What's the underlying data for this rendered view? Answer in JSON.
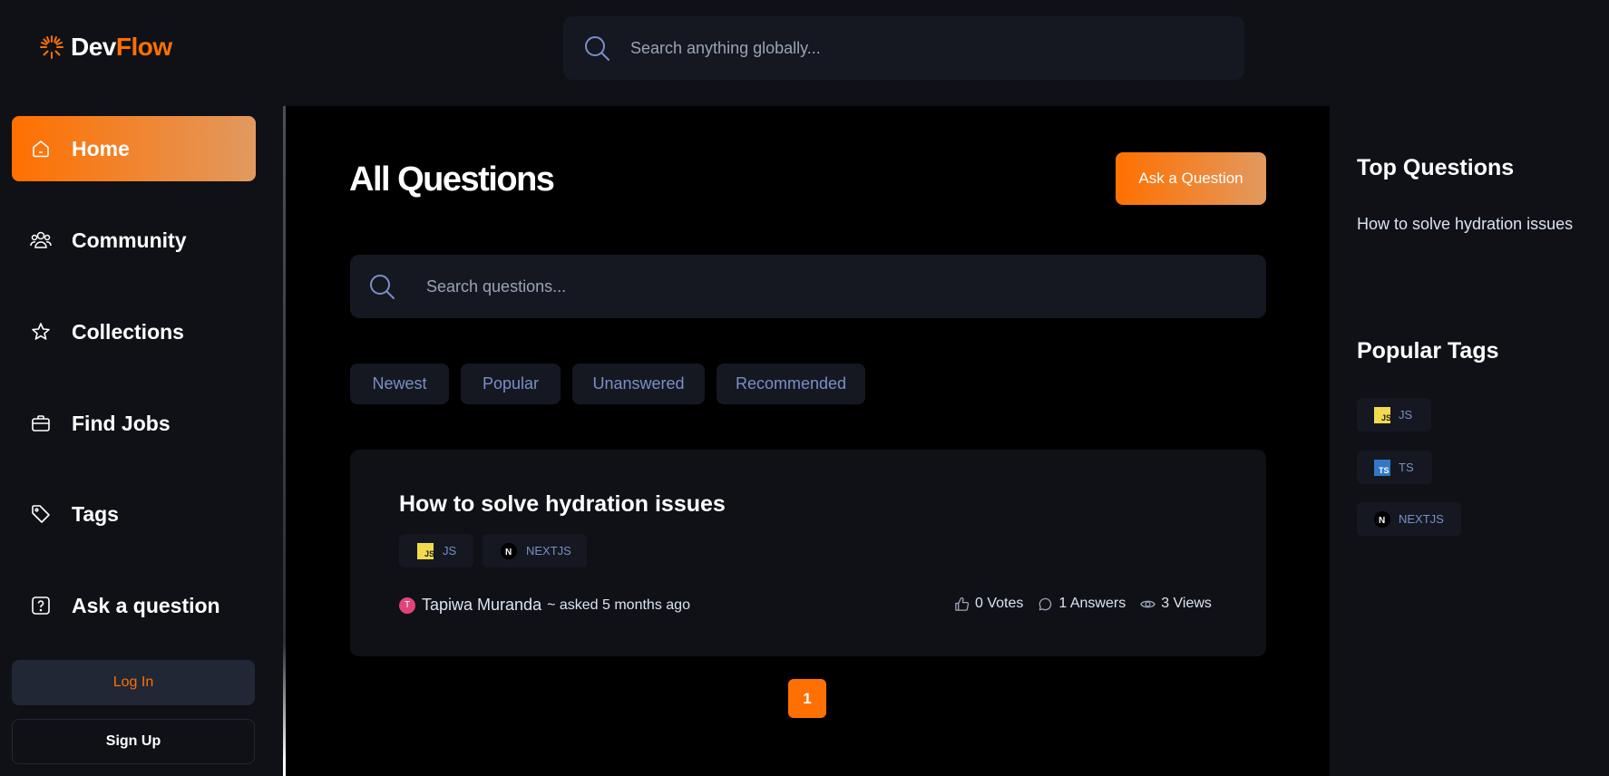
{
  "brand": {
    "part1": "Dev",
    "part2": "Flow"
  },
  "global_search": {
    "placeholder": "Search anything globally..."
  },
  "sidebar": {
    "items": [
      {
        "label": "Home",
        "icon": "home-icon",
        "active": true
      },
      {
        "label": "Community",
        "icon": "users-icon",
        "active": false
      },
      {
        "label": "Collections",
        "icon": "star-icon",
        "active": false
      },
      {
        "label": "Find Jobs",
        "icon": "briefcase-icon",
        "active": false
      },
      {
        "label": "Tags",
        "icon": "tag-icon",
        "active": false
      },
      {
        "label": "Ask a question",
        "icon": "question-icon",
        "active": false
      }
    ],
    "login_label": "Log In",
    "signup_label": "Sign Up"
  },
  "main": {
    "title": "All Questions",
    "ask_button": "Ask a Question",
    "search_placeholder": "Search questions...",
    "filters": [
      "Newest",
      "Popular",
      "Unanswered",
      "Recommended"
    ],
    "questions": [
      {
        "title": "How to solve hydration issues",
        "tags": [
          {
            "label": "JS",
            "icon": "javascript-icon"
          },
          {
            "label": "NEXTJS",
            "icon": "nextjs-icon"
          }
        ],
        "author_initial": "T",
        "author": "Tapiwa Muranda",
        "asked": "~ asked 5 months ago",
        "votes": "0 Votes",
        "answers": "1 Answers",
        "views": "3 Views"
      }
    ],
    "current_page": "1"
  },
  "right_sidebar": {
    "top_questions_title": "Top Questions",
    "top_questions": [
      "How to solve hydration issues"
    ],
    "popular_tags_title": "Popular Tags",
    "popular_tags": [
      {
        "label": "JS",
        "icon": "javascript-icon"
      },
      {
        "label": "TS",
        "icon": "typescript-icon"
      },
      {
        "label": "NEXTJS",
        "icon": "nextjs-icon"
      }
    ]
  },
  "colors": {
    "accent": "#ff7000",
    "accent_light": "#e2995f",
    "background": "#0f1117",
    "surface": "#151821",
    "muted_text": "#7b8ec8"
  }
}
